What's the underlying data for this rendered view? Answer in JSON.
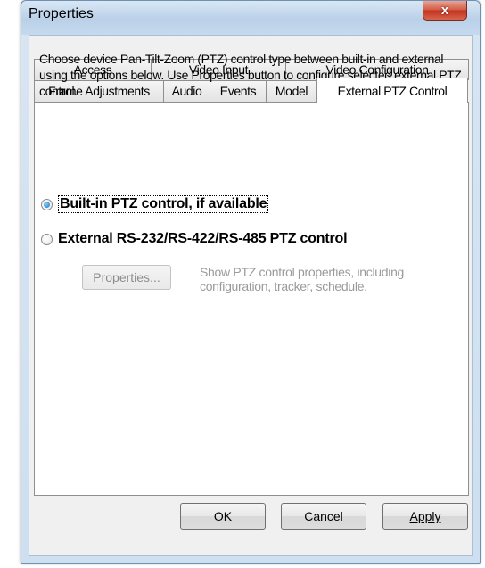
{
  "window": {
    "title": "Properties",
    "close_glyph": "x"
  },
  "tabs": {
    "back_row": [
      "Access",
      "Video Input",
      "Video Configuration"
    ],
    "front_row": [
      "Frame Adjustments",
      "Audio",
      "Events",
      "Model",
      "External PTZ Control"
    ],
    "active": "External PTZ Control"
  },
  "panel": {
    "description": "Choose device Pan-Tilt-Zoom (PTZ) control type between built-in and external using the options below. Use Properties button to configure selected external PTZ control.",
    "option_builtin": "Built-in PTZ control, if available",
    "option_external": "External RS-232/RS-422/RS-485 PTZ control",
    "properties_button": "Properties...",
    "properties_hint": "Show PTZ control properties, including configuration, tracker, schedule."
  },
  "footer": {
    "ok": "OK",
    "cancel": "Cancel",
    "apply": "Apply"
  }
}
